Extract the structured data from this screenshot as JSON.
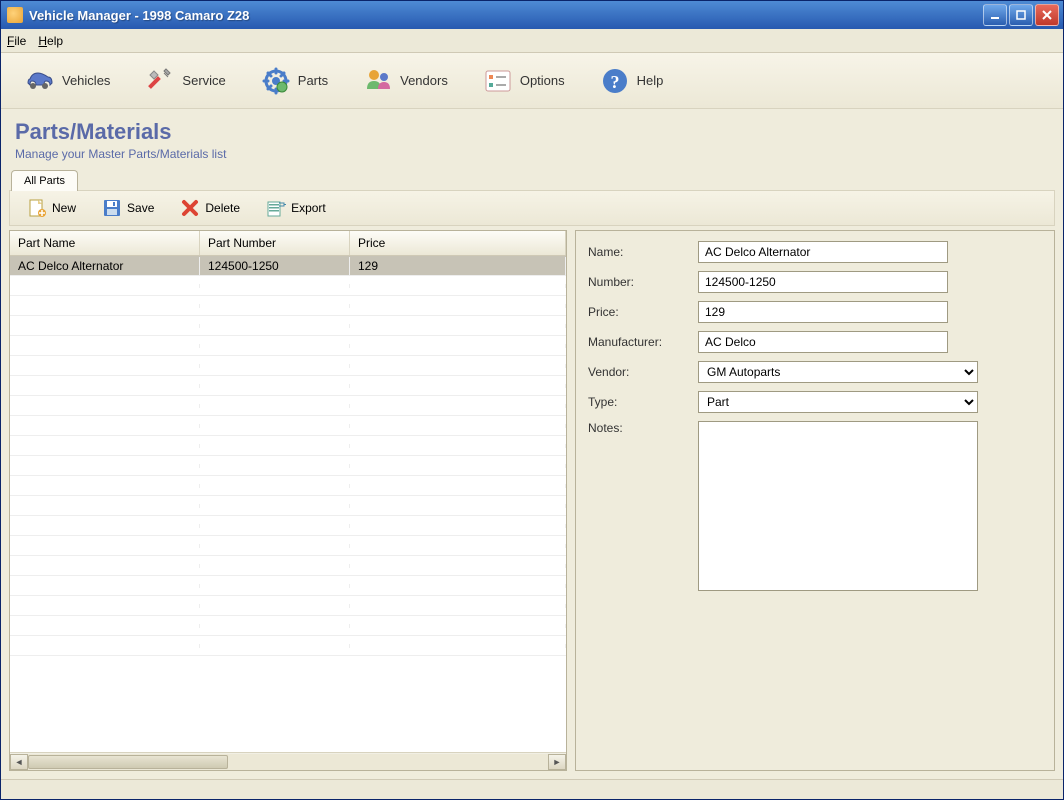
{
  "window": {
    "title": "Vehicle Manager - 1998 Camaro Z28"
  },
  "menubar": {
    "file": "File",
    "help": "Help"
  },
  "toolbar": {
    "vehicles": "Vehicles",
    "service": "Service",
    "parts": "Parts",
    "vendors": "Vendors",
    "options": "Options",
    "help": "Help"
  },
  "page": {
    "title": "Parts/Materials",
    "subtitle": "Manage your Master Parts/Materials list"
  },
  "tabs": {
    "all_parts": "All Parts"
  },
  "actionbar": {
    "new": "New",
    "save": "Save",
    "delete": "Delete",
    "export": "Export"
  },
  "table": {
    "col_name": "Part Name",
    "col_number": "Part Number",
    "col_price": "Price",
    "rows": [
      {
        "name": "AC Delco Alternator",
        "number": "124500-1250",
        "price": "129"
      }
    ]
  },
  "form": {
    "labels": {
      "name": "Name:",
      "number": "Number:",
      "price": "Price:",
      "manufacturer": "Manufacturer:",
      "vendor": "Vendor:",
      "type": "Type:",
      "notes": "Notes:"
    },
    "values": {
      "name": "AC Delco Alternator",
      "number": "124500-1250",
      "price": "129",
      "manufacturer": "AC Delco",
      "vendor": "GM Autoparts",
      "type": "Part",
      "notes": ""
    }
  }
}
